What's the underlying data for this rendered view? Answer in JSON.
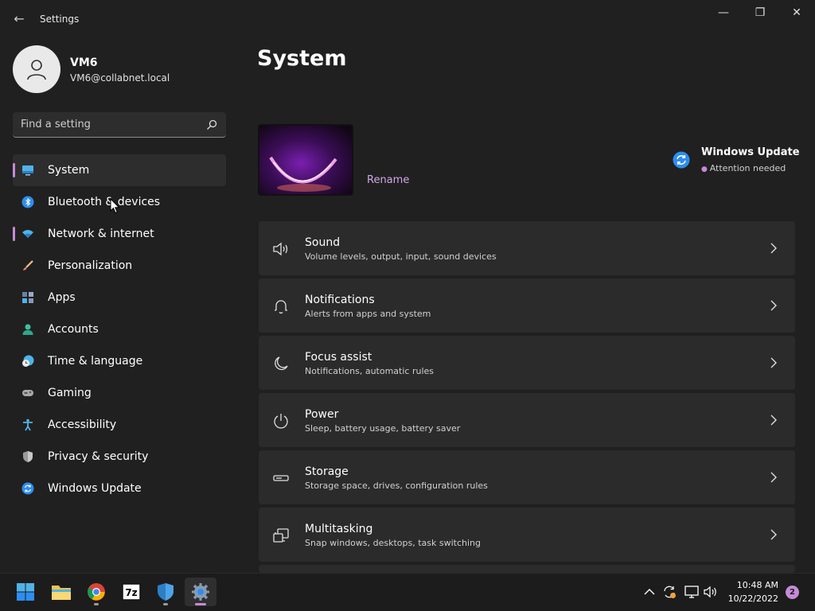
{
  "window": {
    "title": "Settings",
    "back_glyph": "←",
    "minimize_glyph": "—",
    "maximize_glyph": "❐",
    "close_glyph": "✕"
  },
  "user": {
    "name": "VM6",
    "email": "VM6@collabnet.local"
  },
  "search": {
    "placeholder": "Find a setting"
  },
  "nav": [
    {
      "label": "System",
      "icon": "system-icon"
    },
    {
      "label": "Bluetooth & devices",
      "icon": "bluetooth-icon"
    },
    {
      "label": "Network & internet",
      "icon": "wifi-icon"
    },
    {
      "label": "Personalization",
      "icon": "brush-icon"
    },
    {
      "label": "Apps",
      "icon": "apps-icon"
    },
    {
      "label": "Accounts",
      "icon": "accounts-icon"
    },
    {
      "label": "Time & language",
      "icon": "clock-globe-icon"
    },
    {
      "label": "Gaming",
      "icon": "gamepad-icon"
    },
    {
      "label": "Accessibility",
      "icon": "accessibility-icon"
    },
    {
      "label": "Privacy & security",
      "icon": "shield-icon"
    },
    {
      "label": "Windows Update",
      "icon": "update-icon"
    }
  ],
  "main": {
    "title": "System",
    "rename": "Rename",
    "windows_update": {
      "title": "Windows Update",
      "status": "Attention needed"
    },
    "cards": [
      {
        "title": "Sound",
        "subtitle": "Volume levels, output, input, sound devices",
        "icon": "speaker-icon"
      },
      {
        "title": "Notifications",
        "subtitle": "Alerts from apps and system",
        "icon": "bell-icon"
      },
      {
        "title": "Focus assist",
        "subtitle": "Notifications, automatic rules",
        "icon": "moon-icon"
      },
      {
        "title": "Power",
        "subtitle": "Sleep, battery usage, battery saver",
        "icon": "power-icon"
      },
      {
        "title": "Storage",
        "subtitle": "Storage space, drives, configuration rules",
        "icon": "storage-icon"
      },
      {
        "title": "Multitasking",
        "subtitle": "Snap windows, desktops, task switching",
        "icon": "multitasking-icon"
      }
    ]
  },
  "taskbar": {
    "apps": [
      "windows-start-icon",
      "file-explorer-icon",
      "chrome-icon",
      "7zip-icon",
      "defender-icon",
      "settings-gear-icon"
    ],
    "sevenzip_label": "7z",
    "time": "10:48 AM",
    "date": "10/22/2022",
    "notification_count": "2"
  },
  "colors": {
    "background": "#202020",
    "card": "#2b2b2b",
    "accent": "#c58ad8",
    "update_blue": "#2d8ef0"
  }
}
